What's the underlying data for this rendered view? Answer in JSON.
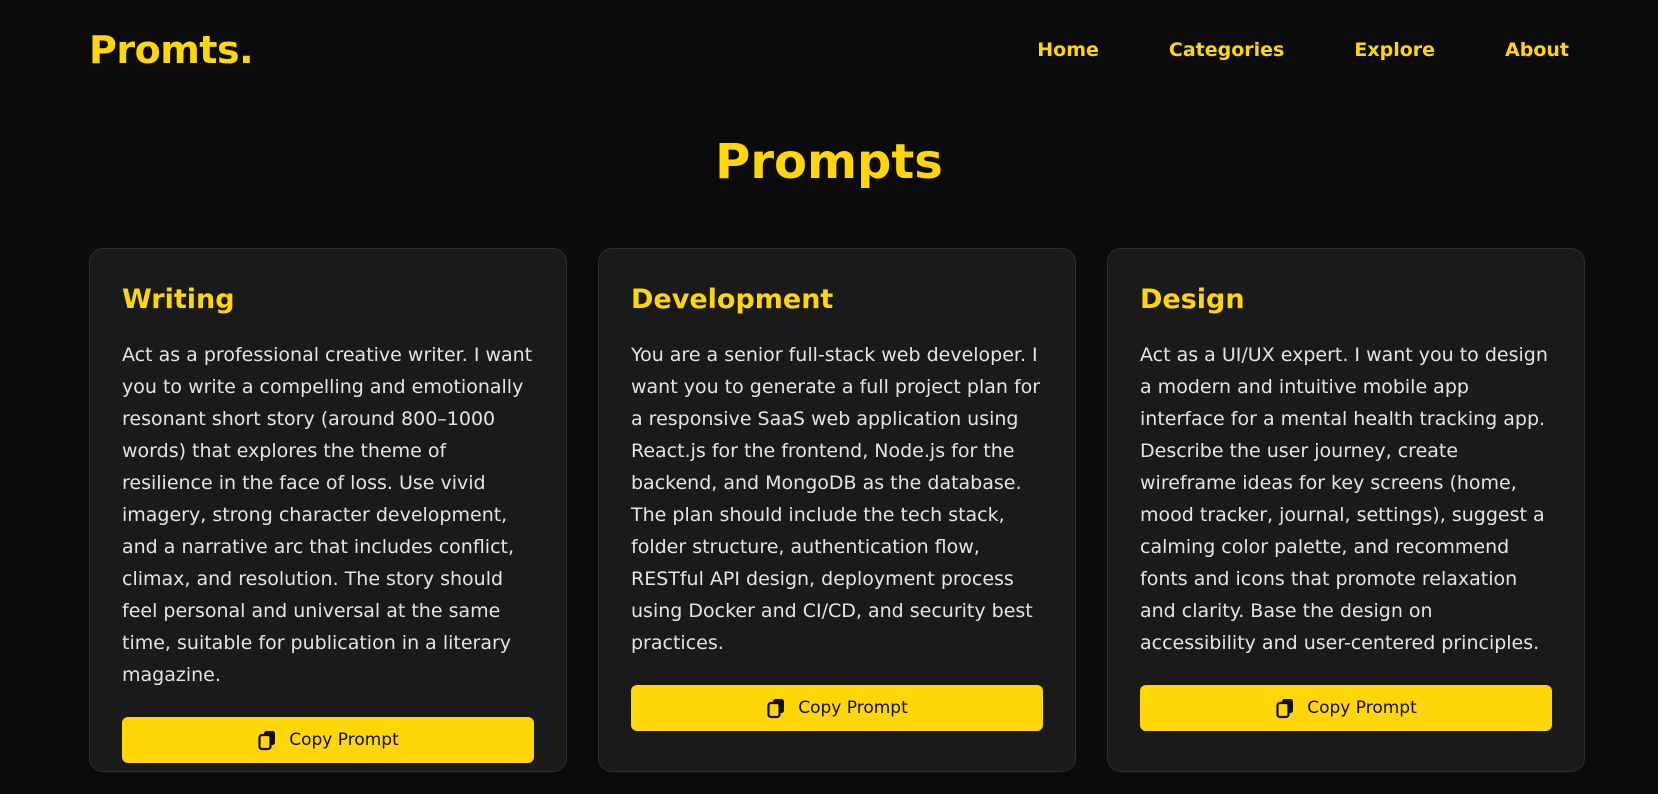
{
  "header": {
    "logo": "Promts.",
    "nav": [
      "Home",
      "Categories",
      "Explore",
      "About"
    ]
  },
  "main": {
    "title": "Prompts",
    "cards": [
      {
        "title": "Writing",
        "text": "Act as a professional creative writer. I want you to write a compelling and emotionally resonant short story (around 800–1000 words) that explores the theme of resilience in the face of loss. Use vivid imagery, strong character development, and a narrative arc that includes conflict, climax, and resolution. The story should feel personal and universal at the same time, suitable for publication in a literary magazine.",
        "button": "Copy Prompt"
      },
      {
        "title": "Development",
        "text": "You are a senior full-stack web developer. I want you to generate a full project plan for a responsive SaaS web application using React.js for the frontend, Node.js for the backend, and MongoDB as the database. The plan should include the tech stack, folder structure, authentication flow, RESTful API design, deployment process using Docker and CI/CD, and security best practices.",
        "button": "Copy Prompt"
      },
      {
        "title": "Design",
        "text": "Act as a UI/UX expert. I want you to design a modern and intuitive mobile app interface for a mental health tracking app. Describe the user journey, create wireframe ideas for key screens (home, mood tracker, journal, settings), suggest a calming color palette, and recommend fonts and icons that promote relaxation and clarity. Base the design on accessibility and user-centered principles.",
        "button": "Copy Prompt"
      }
    ]
  },
  "colors": {
    "accent": "#ffd60a",
    "background": "#0b0b0b",
    "card": "#1a1a1a",
    "text": "#e4e4e4"
  },
  "icons": {
    "copy": "copy-icon"
  }
}
